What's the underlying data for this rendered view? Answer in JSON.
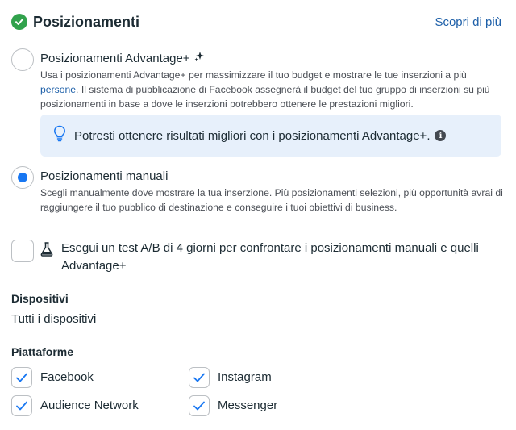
{
  "header": {
    "title": "Posizionamenti",
    "link": "Scopri di più"
  },
  "advantage": {
    "title": "Posizionamenti Advantage+",
    "desc_before_link": "Usa i posizionamenti Advantage+ per massimizzare il tuo budget e mostrare le tue inserzioni a più",
    "desc_link": "persone",
    "desc_after_link": ". Il sistema di pubblicazione di Facebook assegnerà il budget del tuo gruppo di inserzioni su più posizionamenti in base a dove le inserzioni potrebbero ottenere le prestazioni migliori.",
    "selected": false
  },
  "tip": {
    "text": "Potresti ottenere risultati migliori con i posizionamenti Advantage+."
  },
  "manual": {
    "title": "Posizionamenti manuali",
    "desc": "Scegli manualmente dove mostrare la tua inserzione. Più posizionamenti selezioni, più opportunità avrai di raggiungere il tuo pubblico di destinazione e conseguire i tuoi obiettivi di business.",
    "selected": true
  },
  "ab_test": {
    "text": "Esegui un test A/B di 4 giorni per confrontare i posizionamenti manuali e quelli Advantage+",
    "checked": false
  },
  "devices": {
    "title": "Dispositivi",
    "value": "Tutti i dispositivi"
  },
  "platforms": {
    "title": "Piattaforme",
    "items": [
      {
        "label": "Facebook",
        "checked": true
      },
      {
        "label": "Instagram",
        "checked": true
      },
      {
        "label": "Audience Network",
        "checked": true
      },
      {
        "label": "Messenger",
        "checked": true
      }
    ]
  },
  "colors": {
    "accent": "#1877f2",
    "link": "#1d5fa8",
    "success": "#31a24c",
    "tip_bg": "#e7f0fb"
  }
}
